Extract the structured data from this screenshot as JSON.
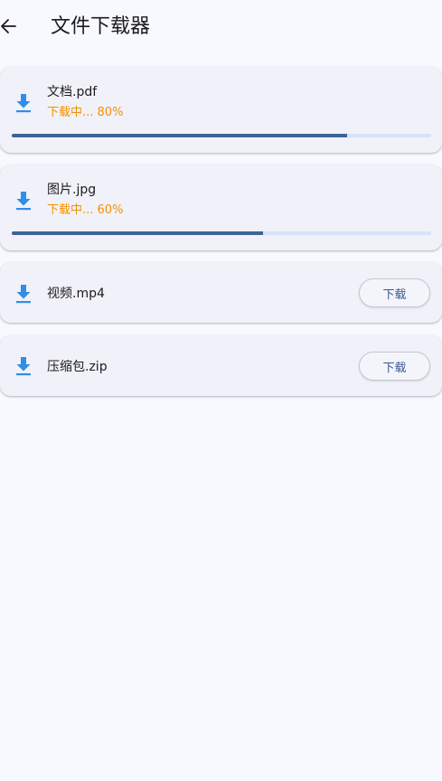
{
  "appbar": {
    "title": "文件下载器",
    "back_icon": "arrow-back-icon"
  },
  "colors": {
    "icon": "#2f8ee8",
    "status": "#f29100",
    "progress_fill": "#3d6496",
    "progress_track": "#d8e2f9",
    "card": "#f1f1f9",
    "background": "#f8f9ff"
  },
  "files": [
    {
      "name": "文档.pdf",
      "status": "下载中... 80%",
      "progress": 0.8,
      "icon": "download-icon"
    },
    {
      "name": "图片.jpg",
      "status": "下载中... 60%",
      "progress": 0.6,
      "icon": "download-icon"
    },
    {
      "name": "视频.mp4",
      "button_label": "下载",
      "icon": "download-icon"
    },
    {
      "name": "压缩包.zip",
      "button_label": "下载",
      "icon": "download-icon"
    }
  ]
}
